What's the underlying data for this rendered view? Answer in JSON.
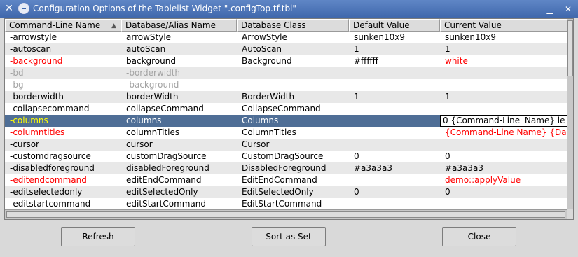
{
  "window": {
    "title": "Configuration Options of the Tablelist Widget \".configTop.tf.tbl\""
  },
  "columns": [
    {
      "label": "Command-Line Name",
      "sorted": true
    },
    {
      "label": "Database/Alias Name"
    },
    {
      "label": "Database Class"
    },
    {
      "label": "Default Value"
    },
    {
      "label": "Current Value"
    }
  ],
  "rows": [
    {
      "cells": [
        "-arrowstyle",
        "arrowStyle",
        "ArrowStyle",
        "sunken10x9",
        "sunken10x9"
      ]
    },
    {
      "cells": [
        "-autoscan",
        "autoScan",
        "AutoScan",
        "1",
        "1"
      ]
    },
    {
      "cells": [
        "-background",
        "background",
        "Background",
        "#ffffff",
        "white"
      ],
      "status": "modified"
    },
    {
      "cells": [
        "-bd",
        "-borderwidth",
        "",
        "",
        ""
      ],
      "status": "alias"
    },
    {
      "cells": [
        "-bg",
        "-background",
        "",
        "",
        ""
      ],
      "status": "alias"
    },
    {
      "cells": [
        "-borderwidth",
        "borderWidth",
        "BorderWidth",
        "1",
        "1"
      ]
    },
    {
      "cells": [
        "-collapsecommand",
        "collapseCommand",
        "CollapseCommand",
        "",
        ""
      ]
    },
    {
      "cells": [
        "-columns",
        "columns",
        "Columns",
        "",
        ""
      ],
      "status": "selected"
    },
    {
      "cells": [
        "-columntitles",
        "columnTitles",
        "ColumnTitles",
        "",
        "{Command-Line Name} {Da"
      ],
      "status": "modified"
    },
    {
      "cells": [
        "-cursor",
        "cursor",
        "Cursor",
        "",
        ""
      ]
    },
    {
      "cells": [
        "-customdragsource",
        "customDragSource",
        "CustomDragSource",
        "0",
        "0"
      ]
    },
    {
      "cells": [
        "-disabledforeground",
        "disabledForeground",
        "DisabledForeground",
        "#a3a3a3",
        "#a3a3a3"
      ]
    },
    {
      "cells": [
        "-editendcommand",
        "editEndCommand",
        "EditEndCommand",
        "",
        "demo::applyValue"
      ],
      "status": "modified"
    },
    {
      "cells": [
        "-editselectedonly",
        "editSelectedOnly",
        "EditSelectedOnly",
        "0",
        "0"
      ]
    },
    {
      "cells": [
        "-editstartcommand",
        "editStartCommand",
        "EditStartCommand",
        "",
        ""
      ]
    }
  ],
  "editor": {
    "before_caret": "0 {Command-Line",
    "after_caret": " Name} le"
  },
  "buttons": {
    "refresh": "Refresh",
    "sort": "Sort as Set",
    "close": "Close"
  },
  "colors": {
    "title_bar": "#4f76b8",
    "modified_text": "#ff0000",
    "alias_text": "#a3a3a3",
    "selection_bg": "#4f6e96",
    "selection_option_text": "#ffff00"
  }
}
